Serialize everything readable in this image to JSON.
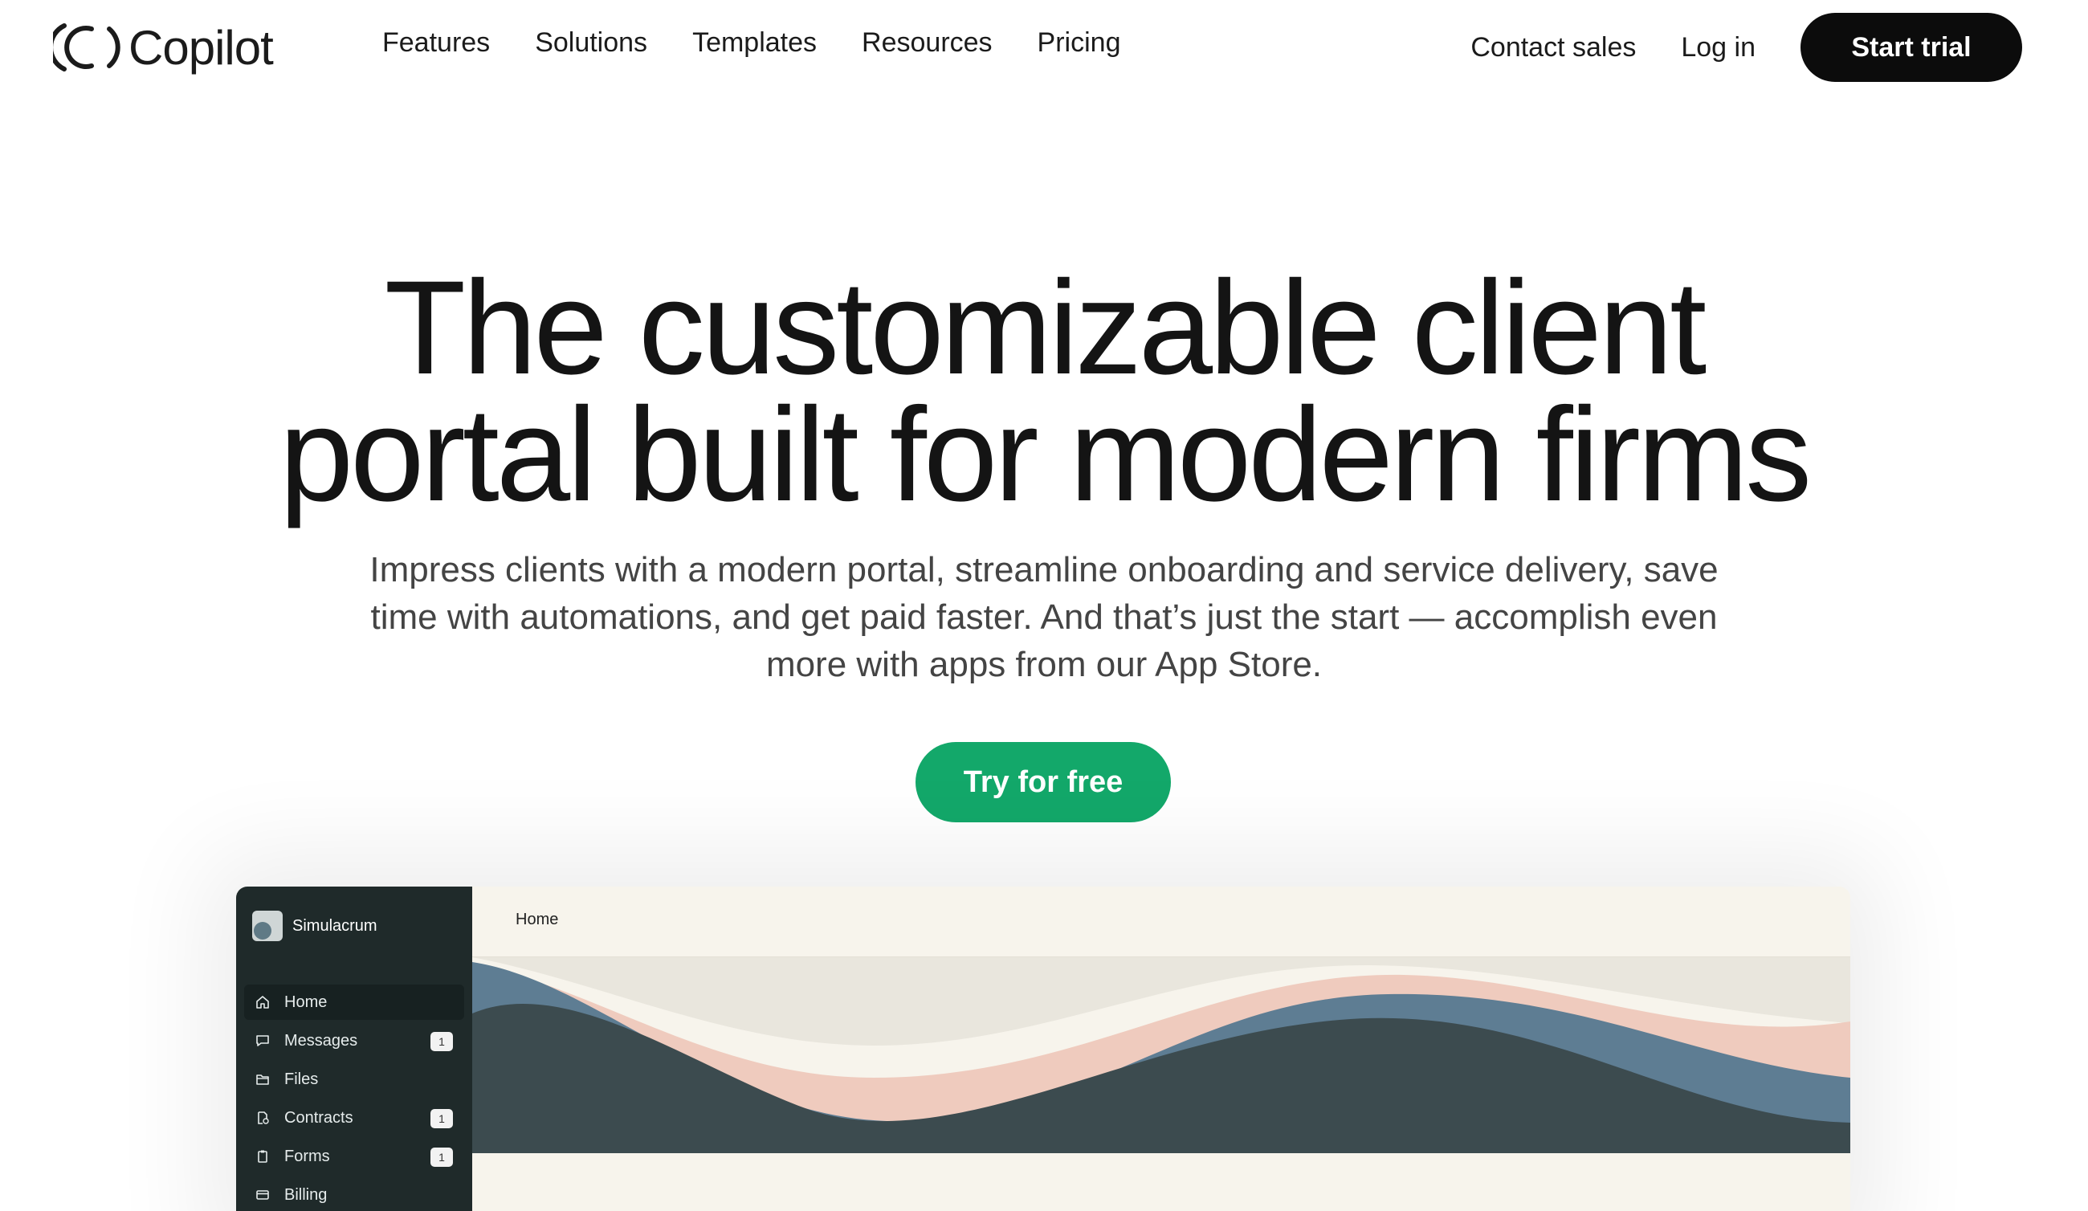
{
  "brand": {
    "name": "Copilot"
  },
  "nav": {
    "links": [
      "Features",
      "Solutions",
      "Templates",
      "Resources",
      "Pricing"
    ],
    "contact_sales": "Contact sales",
    "login": "Log in",
    "start_trial": "Start trial"
  },
  "hero": {
    "title_line1": "The customizable client",
    "title_line2": "portal built for modern firms",
    "subtitle_line1": "Impress clients with a modern portal, streamline onboarding and service delivery, save",
    "subtitle_line2": "time with automations, and get paid faster. And that’s just the start — accomplish even",
    "subtitle_line3": "more with apps from our App Store.",
    "cta": "Try for free"
  },
  "colors": {
    "cta_green": "#13a86a",
    "nav_button": "#0c0c0c",
    "sidebar_bg": "#1f2a2a",
    "portal_bg": "#f7f4ec"
  },
  "mockup": {
    "workspace": "Simulacrum",
    "header_title": "Home",
    "sidebar": [
      {
        "label": "Home",
        "icon": "home-icon",
        "active": true,
        "badge": ""
      },
      {
        "label": "Messages",
        "icon": "message-icon",
        "active": false,
        "badge": "1"
      },
      {
        "label": "Files",
        "icon": "folder-icon",
        "active": false,
        "badge": ""
      },
      {
        "label": "Contracts",
        "icon": "contract-icon",
        "active": false,
        "badge": "1"
      },
      {
        "label": "Forms",
        "icon": "clipboard-icon",
        "active": false,
        "badge": "1"
      },
      {
        "label": "Billing",
        "icon": "card-icon",
        "active": false,
        "badge": ""
      }
    ]
  }
}
